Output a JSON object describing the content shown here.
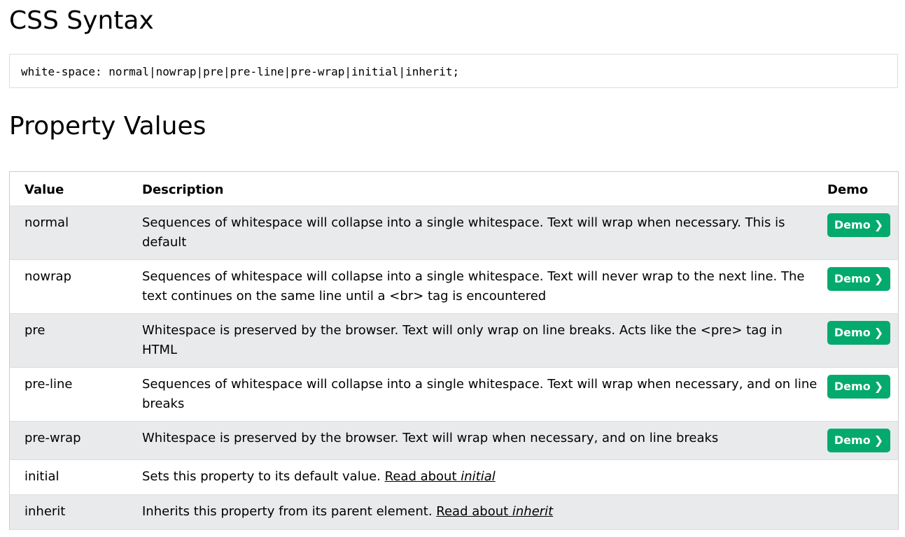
{
  "headings": {
    "syntax": "CSS Syntax",
    "values": "Property Values"
  },
  "syntax_code": "white-space: normal|nowrap|pre|pre-line|pre-wrap|initial|inherit;",
  "table": {
    "headers": {
      "value": "Value",
      "description": "Description",
      "demo": "Demo"
    },
    "rows": [
      {
        "value": "normal",
        "description": "Sequences of whitespace will collapse into a single whitespace. Text will wrap when necessary. This is default",
        "demo": "Demo"
      },
      {
        "value": "nowrap",
        "description": "Sequences of whitespace will collapse into a single whitespace. Text will never wrap to the next line. The text continues on the same line until a <br> tag is encountered",
        "demo": "Demo"
      },
      {
        "value": "pre",
        "description": "Whitespace is preserved by the browser. Text will only wrap on line breaks. Acts like the <pre> tag in HTML",
        "demo": "Demo"
      },
      {
        "value": "pre-line",
        "description": "Sequences of whitespace will collapse into a single whitespace. Text will wrap when necessary, and on line breaks",
        "demo": "Demo"
      },
      {
        "value": "pre-wrap",
        "description": "Whitespace is preserved by the browser. Text will wrap when necessary, and on line breaks",
        "demo": "Demo"
      },
      {
        "value": "initial",
        "description": "Sets this property to its default value.",
        "link_text": "Read about ",
        "link_em": "initial"
      },
      {
        "value": "inherit",
        "description": "Inherits this property from its parent element.",
        "link_text": "Read about ",
        "link_em": "inherit"
      }
    ]
  },
  "demo_chevron": "❯",
  "colors": {
    "demo_button": "#04aa6d",
    "shaded_row": "#e9eaec"
  }
}
